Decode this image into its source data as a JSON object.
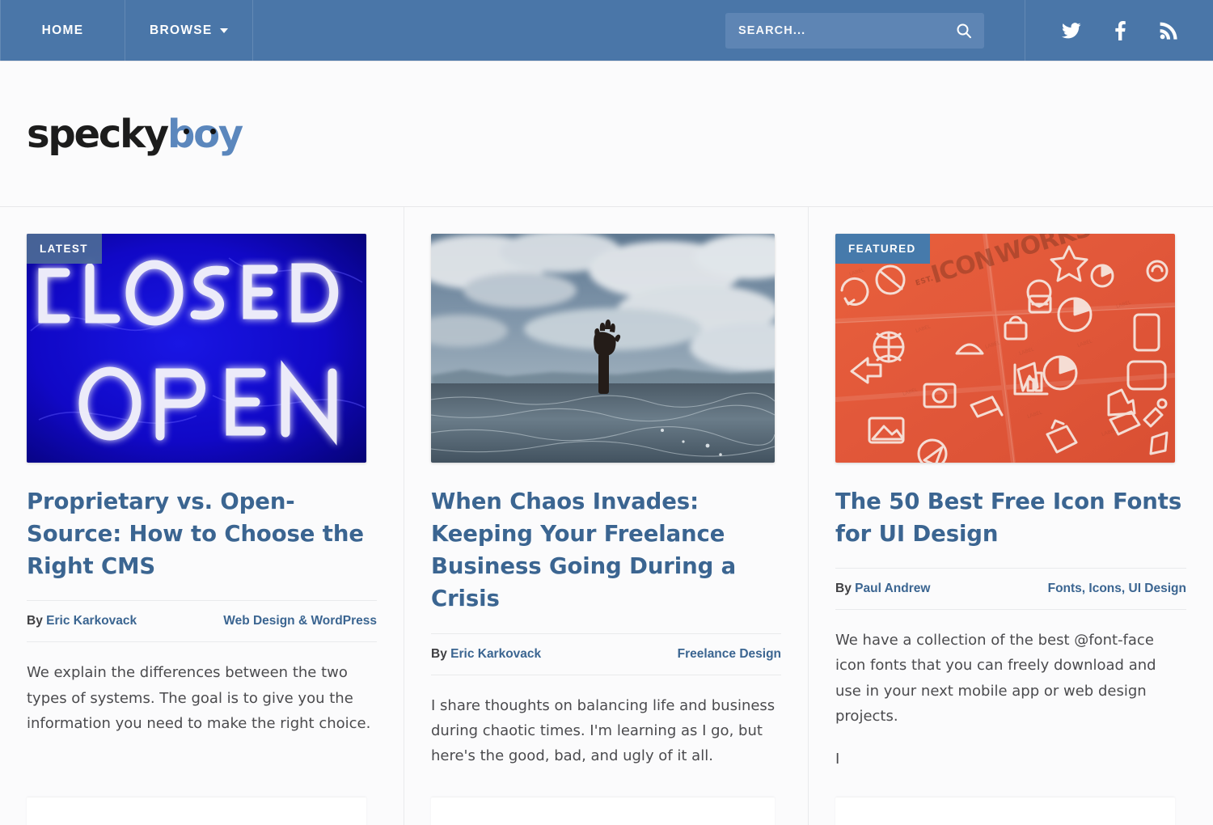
{
  "nav": {
    "items": [
      {
        "label": "HOME",
        "has_caret": false
      },
      {
        "label": "BROWSE",
        "has_caret": true
      }
    ],
    "search": {
      "placeholder": "SEARCH...",
      "value": "",
      "button_icon": "search-icon"
    },
    "social": [
      {
        "name": "twitter-icon",
        "label": "Twitter"
      },
      {
        "name": "facebook-icon",
        "label": "Facebook"
      },
      {
        "name": "rss-icon",
        "label": "RSS"
      }
    ],
    "background_color": "#4a76a8"
  },
  "brand": {
    "name_part_1": "specky",
    "name_part_2": "boy",
    "part_1_color": "#1c1c1c",
    "part_2_color": "#5b87bd"
  },
  "accent_color": "#3b6591",
  "page_background": "#fbfbfc",
  "cards": [
    {
      "badge": "LATEST",
      "badge_style": "latest",
      "image": "neon-closed-open-sign",
      "image_alt": "Blue neon sign reading CLOSED OPEN",
      "title": "Proprietary vs. Open-Source: How to Choose the Right CMS",
      "by_label": "By",
      "author": "Eric Karkovack",
      "categories": "Web Design & WordPress",
      "excerpt": "We explain the differences between the two types of systems. The goal is to give you the information you need to make the right choice.",
      "trailing_text": ""
    },
    {
      "badge": "",
      "badge_style": "",
      "image": "hand-reaching-from-ocean",
      "image_alt": "A hand reaching out of stormy ocean water under cloudy sky",
      "title": "When Chaos Invades: Keeping Your Freelance Business Going During a Crisis",
      "by_label": "By",
      "author": "Eric Karkovack",
      "categories": "Freelance Design",
      "excerpt": "I share thoughts on balancing life and business during chaotic times. I'm learning as I go, but here's the good, bad, and ugly of it all.",
      "trailing_text": ""
    },
    {
      "badge": "FEATURED",
      "badge_style": "featured",
      "image": "orange-icon-works-poster",
      "image_alt": "Orange poster covered in white line icons, branded ICON WORKS",
      "title": "The 50 Best Free Icon Fonts for UI Design",
      "by_label": "By",
      "author": "Paul Andrew",
      "categories": "Fonts, Icons, UI Design",
      "excerpt": "We have a collection of the best @font-face icon fonts that you can freely download and use in your next mobile app or web design projects.",
      "trailing_text": "I"
    }
  ]
}
